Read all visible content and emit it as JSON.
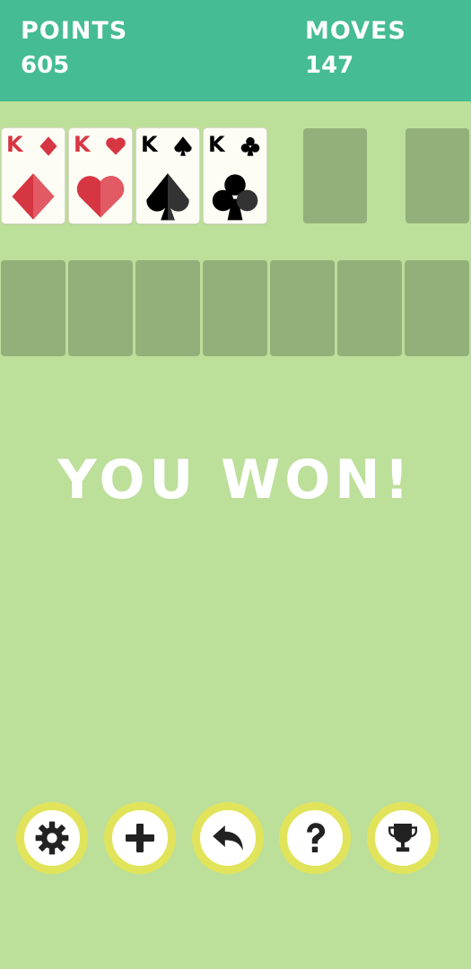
{
  "header": {
    "points_label": "POINTS",
    "points_value": "605",
    "moves_label": "MOVES",
    "moves_value": "147"
  },
  "foundations": [
    {
      "rank": "K",
      "suit": "diamonds",
      "color": "#d63642"
    },
    {
      "rank": "K",
      "suit": "hearts",
      "color": "#d63642"
    },
    {
      "rank": "K",
      "suit": "spades",
      "color": "#000000"
    },
    {
      "rank": "K",
      "suit": "clubs",
      "color": "#000000"
    }
  ],
  "message": "YOU WON!",
  "toolbar": [
    {
      "icon": "gear-icon"
    },
    {
      "icon": "plus-icon"
    },
    {
      "icon": "undo-icon"
    },
    {
      "icon": "help-icon"
    },
    {
      "icon": "trophy-icon"
    }
  ],
  "colors": {
    "background": "#bcdf9a",
    "header": "#45bc93",
    "slot": "#93b07a",
    "button_ring": "#e1e45a"
  }
}
